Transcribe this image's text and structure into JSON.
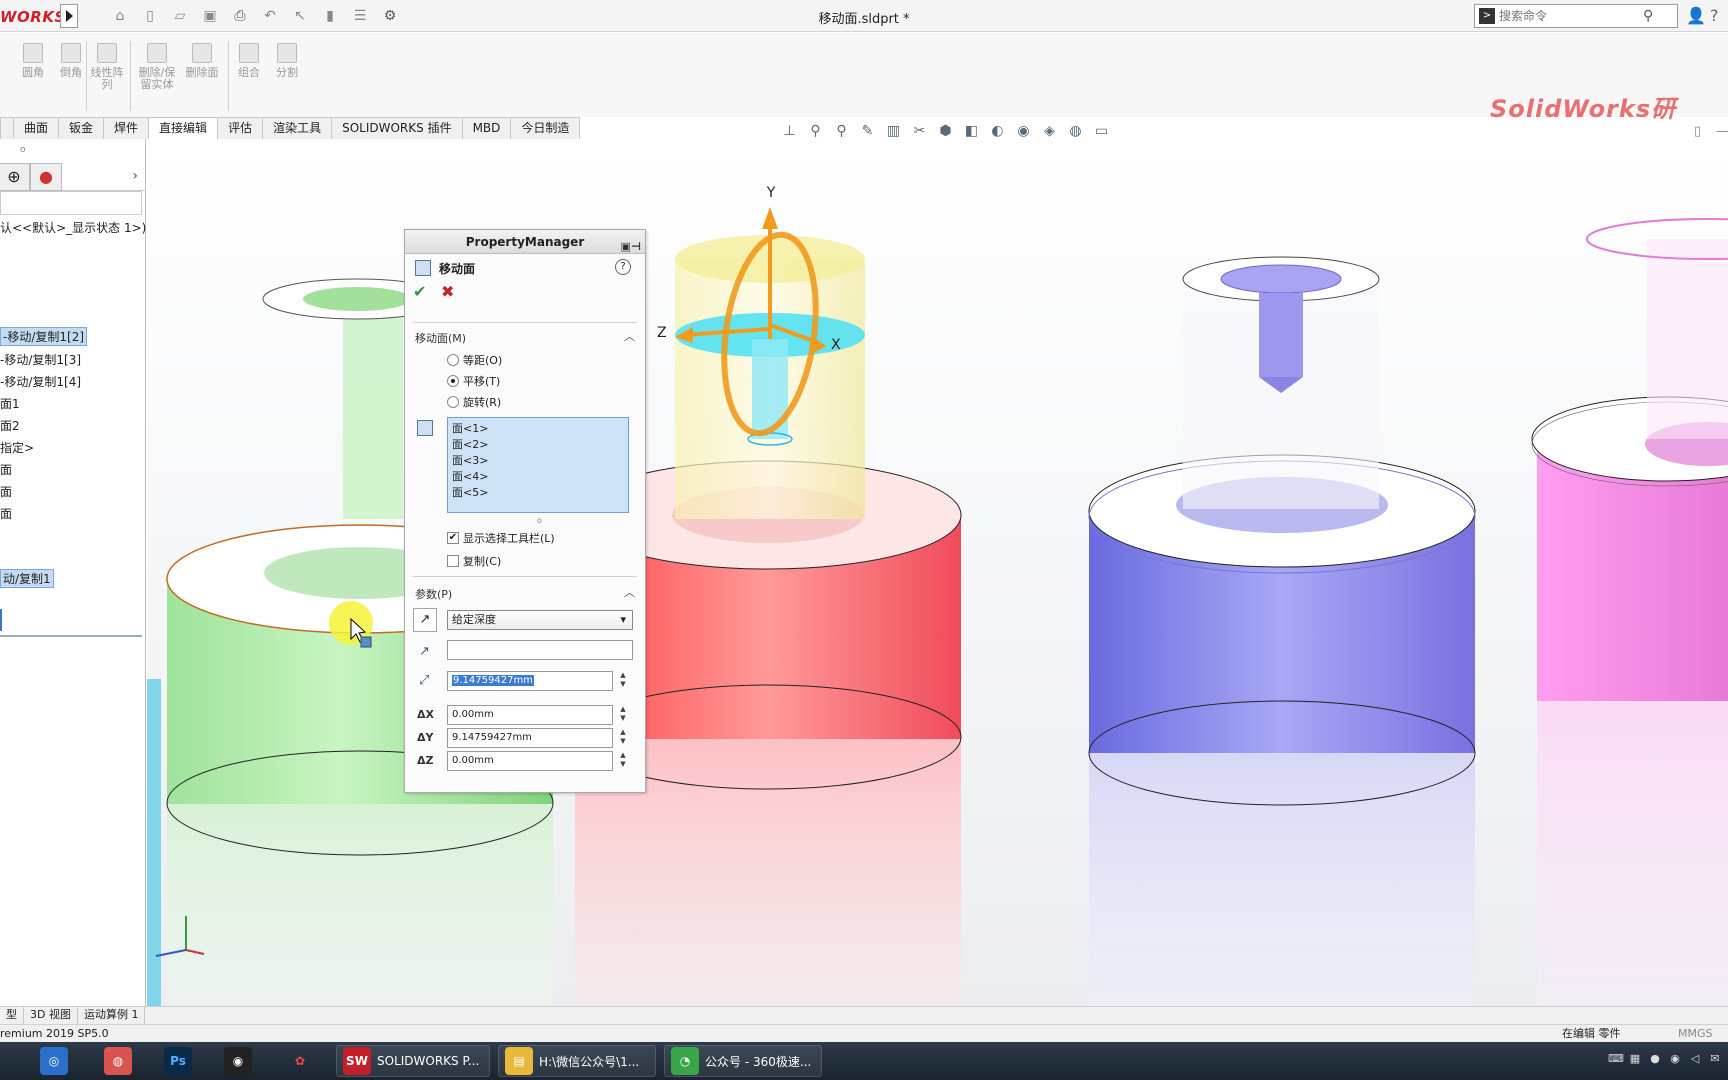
{
  "titlebar": {
    "logo": "WORKS",
    "doc_title": "移动面.sldprt *",
    "search_placeholder": "搜索命令"
  },
  "ribbon": {
    "buttons": [
      "圆角",
      "倒角",
      "线性阵列",
      "删除/保留实体",
      "删除面",
      "组合",
      "分割"
    ],
    "brand": "SolidWorks研"
  },
  "tabs": [
    "曲面",
    "钣金",
    "焊件",
    "直接编辑",
    "评估",
    "渲染工具",
    "SOLIDWORKS 插件",
    "MBD",
    "今日制造"
  ],
  "active_tab": "直接编辑",
  "tree": {
    "header": "认<<默认>_显示状态 1>)",
    "items": [
      "-移动/复制1[2]",
      "-移动/复制1[3]",
      "-移动/复制1[4]",
      "面1",
      "面2",
      "指定>",
      "面",
      "面",
      "面"
    ],
    "selected_bottom": "动/复制1"
  },
  "axes": {
    "x": "X",
    "y": "Y",
    "z": "Z"
  },
  "pm": {
    "header": "PropertyManager",
    "title": "移动面",
    "section_move": "移动面(M)",
    "radio_offset": "等距(O)",
    "radio_translate": "平移(T)",
    "radio_rotate": "旋转(R)",
    "faces": [
      "面<1>",
      "面<2>",
      "面<3>",
      "面<4>",
      "面<5>"
    ],
    "show_toolbar": "显示选择工具栏(L)",
    "copy": "复制(C)",
    "section_params": "参数(P)",
    "end_condition": "给定深度",
    "distance": "9.14759427mm",
    "dx": "0.00mm",
    "dy": "9.14759427mm",
    "dz": "0.00mm",
    "delta_x": "ΔX",
    "delta_y": "ΔY",
    "delta_z": "ΔZ"
  },
  "bottom_tabs": [
    "型",
    "3D 视图",
    "运动算例 1"
  ],
  "status": {
    "version": "remium 2019 SP5.0",
    "edit_mode": "在编辑 零件",
    "units": "MMGS"
  },
  "taskbar": {
    "sw_label": "SOLIDWORKS P...",
    "folder_label": "H:\\微信公众号\\1...",
    "browser_label": "公众号 - 360极速..."
  }
}
